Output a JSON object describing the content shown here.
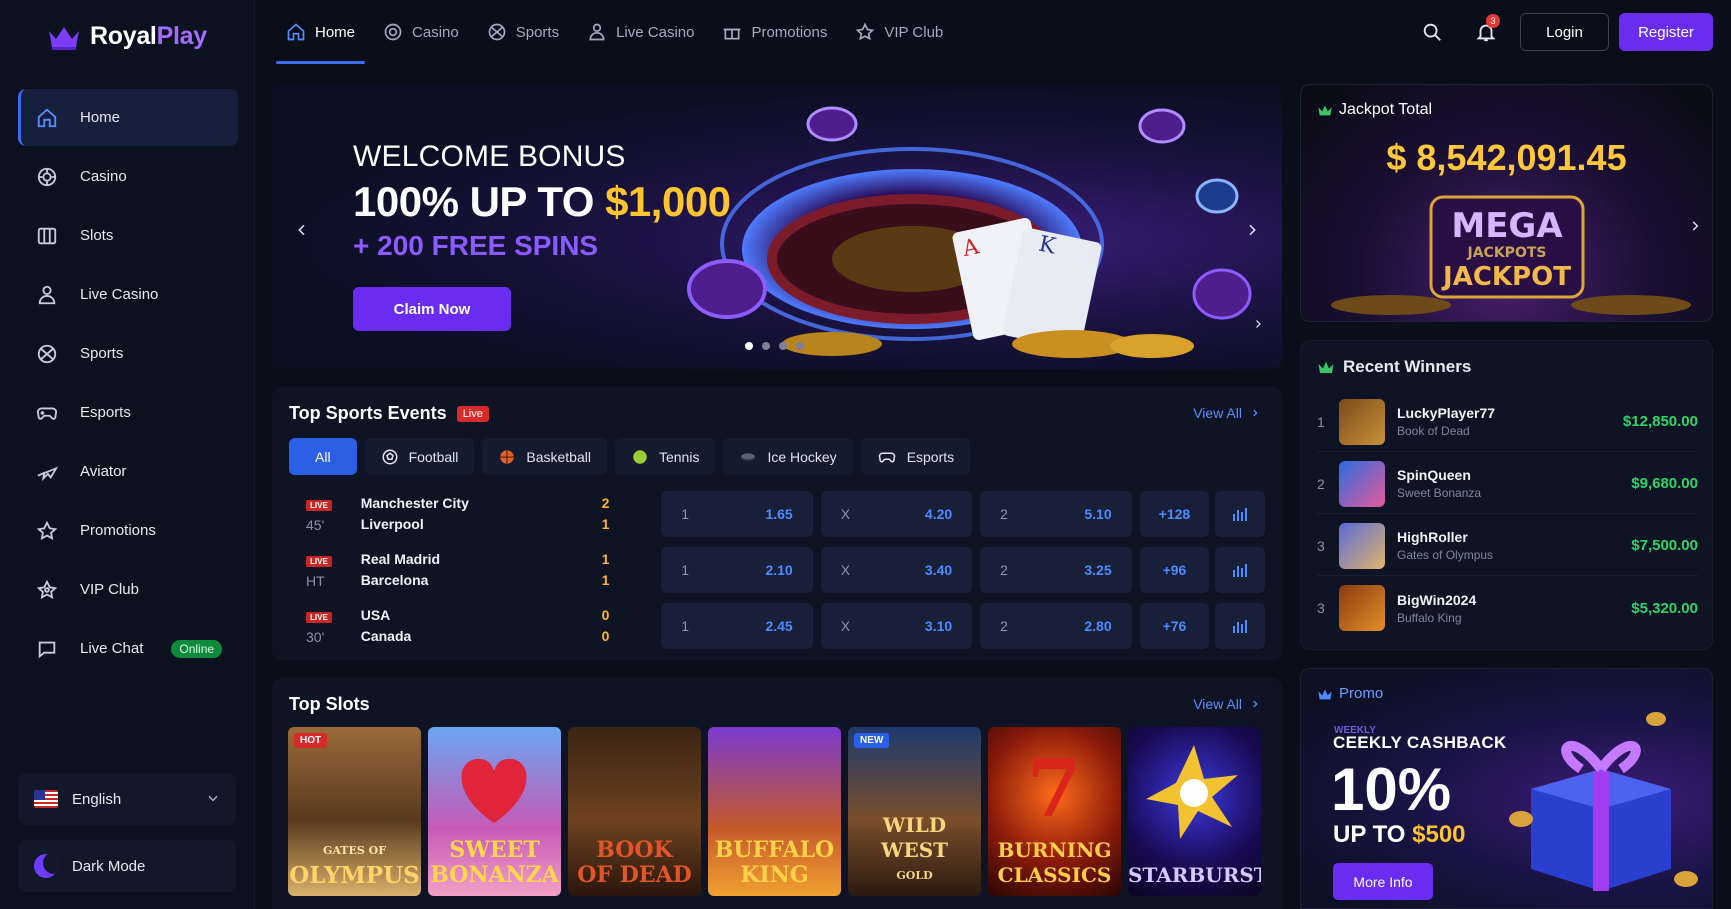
{
  "brand": {
    "name_main": "Royal",
    "name_accent": "Play"
  },
  "sidebar": {
    "items": [
      {
        "label": "Home",
        "icon": "home-icon"
      },
      {
        "label": "Casino",
        "icon": "casino-chip-icon"
      },
      {
        "label": "Slots",
        "icon": "slots-icon"
      },
      {
        "label": "Live Casino",
        "icon": "live-dealer-icon"
      },
      {
        "label": "Sports",
        "icon": "sports-ball-icon"
      },
      {
        "label": "Esports",
        "icon": "gamepad-icon"
      },
      {
        "label": "Aviator",
        "icon": "plane-icon"
      },
      {
        "label": "Promotions",
        "icon": "gift-icon"
      },
      {
        "label": "VIP Club",
        "icon": "crown-icon"
      },
      {
        "label": "Live Chat",
        "icon": "chat-icon",
        "badge": "Online"
      }
    ],
    "language": "English",
    "theme_toggle": "Dark Mode"
  },
  "topnav": {
    "items": [
      "Home",
      "Casino",
      "Sports",
      "Live Casino",
      "Promotions",
      "VIP Club"
    ],
    "notifications_count": "3",
    "login": "Login",
    "register": "Register"
  },
  "hero": {
    "line1": "WELCOME BONUS",
    "line2_prefix": "100% UP TO ",
    "line2_amount": "$1,000",
    "line3": "+ 200 FREE SPINS",
    "cta": "Claim Now",
    "slide_count": 4,
    "active_slide": 1
  },
  "jackpot": {
    "label": "Jackpot Total",
    "amount": "$ 8,542,091.45",
    "logo_line1": "MEGA",
    "logo_line2": "JACKPOTS",
    "logo_line3": "JACKPOT"
  },
  "winners": {
    "title": "Recent Winners",
    "rows": [
      {
        "rank": "1",
        "name": "LuckyPlayer77",
        "game": "Book of Dead",
        "amount": "$12,850.00"
      },
      {
        "rank": "2",
        "name": "SpinQueen",
        "game": "Sweet Bonanza",
        "amount": "$9,680.00"
      },
      {
        "rank": "3",
        "name": "HighRoller",
        "game": "Gates of Olympus",
        "amount": "$7,500.00"
      },
      {
        "rank": "3",
        "name": "BigWin2024",
        "game": "Buffalo King",
        "amount": "$5,320.00"
      }
    ]
  },
  "sports": {
    "title": "Top Sports Events",
    "live_badge": "Live",
    "view_all": "View All",
    "filters": [
      "All",
      "Football",
      "Basketball",
      "Tennis",
      "Ice Hockey",
      "Esports"
    ],
    "live_tag": "LIVE",
    "matches": [
      {
        "time": "45'",
        "home": "Manchester City",
        "away": "Liverpool",
        "home_score": "2",
        "away_score": "1",
        "odds": [
          {
            "label": "1",
            "value": "1.65"
          },
          {
            "label": "X",
            "value": "4.20"
          },
          {
            "label": "2",
            "value": "5.10"
          }
        ],
        "more": "+128"
      },
      {
        "time": "HT",
        "home": "Real Madrid",
        "away": "Barcelona",
        "home_score": "1",
        "away_score": "1",
        "odds": [
          {
            "label": "1",
            "value": "2.10"
          },
          {
            "label": "X",
            "value": "3.40"
          },
          {
            "label": "2",
            "value": "3.25"
          }
        ],
        "more": "+96"
      },
      {
        "time": "30'",
        "home": "USA",
        "away": "Canada",
        "home_score": "0",
        "away_score": "0",
        "odds": [
          {
            "label": "1",
            "value": "2.45"
          },
          {
            "label": "X",
            "value": "3.10"
          },
          {
            "label": "2",
            "value": "2.80"
          }
        ],
        "more": "+76"
      }
    ]
  },
  "slots": {
    "title": "Top Slots",
    "view_all": "View All",
    "games": [
      {
        "line1": "GATES OF",
        "line2": "OLYMPUS",
        "badge": "HOT"
      },
      {
        "line1": "SWEET",
        "line2": "BONANZA",
        "badge": ""
      },
      {
        "line1": "BOOK",
        "line2": "OF DEAD",
        "badge": ""
      },
      {
        "line1": "BUFFALO",
        "line2": "KING",
        "badge": ""
      },
      {
        "line1": "WILD WEST",
        "line2": "GOLD",
        "badge": "NEW"
      },
      {
        "line1": "BURNING",
        "line2": "CLASSICS",
        "badge": ""
      },
      {
        "line1": "STARBURST",
        "line2": "",
        "badge": ""
      }
    ]
  },
  "promo": {
    "label": "Promo",
    "weekly": "WEEKLY",
    "subtitle": "CEEKLY CASHBACK",
    "big": "10%",
    "upto_prefix": "UP TO ",
    "upto_amount": "$500",
    "cta": "More Info"
  },
  "colors": {
    "accent": "#6a2cf0",
    "link": "#4e8bff",
    "gold": "#ffc42e",
    "win": "#2fd468",
    "live": "#d72b2b"
  }
}
